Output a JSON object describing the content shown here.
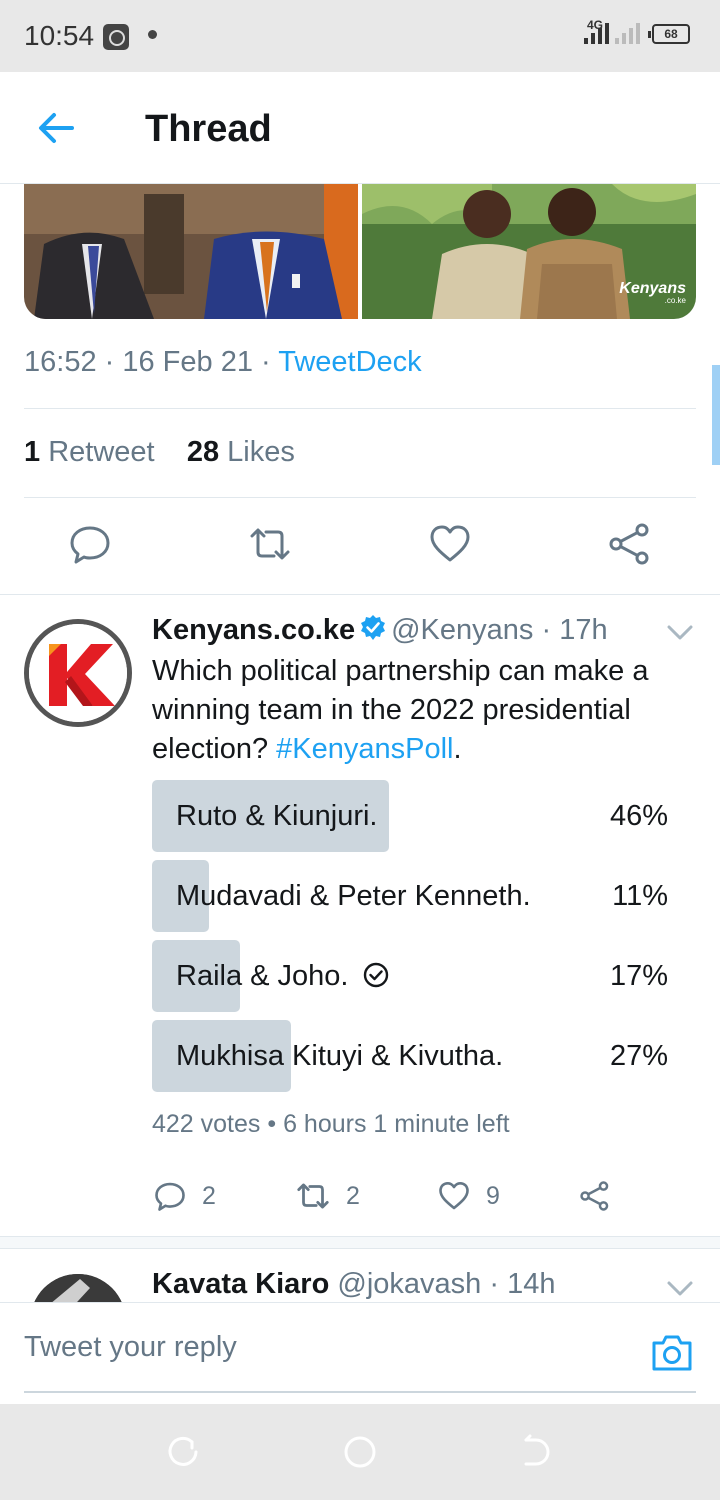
{
  "status_bar": {
    "time": "10:54",
    "network": "4G",
    "battery": "68",
    "icons": [
      "music-app-icon",
      "notification-dot-icon",
      "signal-icon",
      "battery-icon"
    ]
  },
  "header": {
    "title": "Thread",
    "back_icon": "arrow-left-icon"
  },
  "main_tweet": {
    "image_watermark": "Kenyans",
    "image_watermark_sub": ".co.ke",
    "time": "16:52",
    "date": "16 Feb 21",
    "source": "TweetDeck",
    "retweet_count": "1",
    "retweet_label": "Retweet",
    "like_count": "28",
    "like_label": "Likes",
    "actions": [
      "reply-icon",
      "retweet-icon",
      "like-icon",
      "share-icon"
    ]
  },
  "poll_tweet": {
    "author_name": "Kenyans.co.ke",
    "handle": "@Kenyans",
    "time": "17h",
    "text": "Which political partnership can make a winning team in the 2022 presidential election? ",
    "hashtag": "#KenyansPoll",
    "text_end": ".",
    "poll": {
      "options": [
        {
          "label": "Ruto & Kiunjuri.",
          "percent": "46%",
          "value": 0.46,
          "selected": false
        },
        {
          "label": "Mudavadi & Peter Kenneth.",
          "percent": "11%",
          "value": 0.11,
          "selected": false
        },
        {
          "label": "Raila & Joho.",
          "percent": "17%",
          "value": 0.17,
          "selected": true
        },
        {
          "label": "Mukhisa Kituyi & Kivutha.",
          "percent": "27%",
          "value": 0.27,
          "selected": false
        }
      ],
      "votes": "422 votes",
      "time_left": "6 hours 1 minute left"
    },
    "reply_count": "2",
    "retweet_count": "2",
    "like_count": "9"
  },
  "next_tweet": {
    "author_name": "Kavata Kiaro",
    "handle": "@jokavash",
    "time": "14h"
  },
  "reply_bar": {
    "placeholder": "Tweet your reply",
    "camera_icon": "camera-icon"
  },
  "colors": {
    "accent": "#1da1f2",
    "poll_fill": "#ccd6dd",
    "secondary_text": "#657786"
  }
}
